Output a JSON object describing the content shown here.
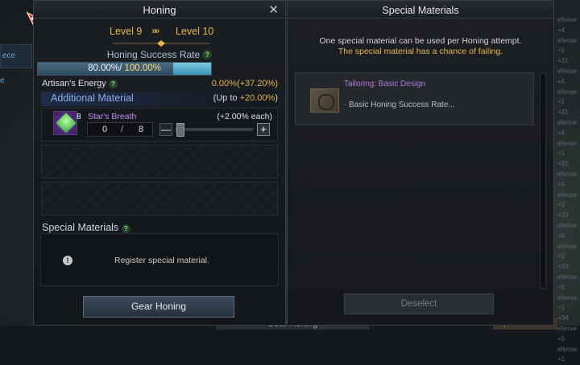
{
  "honing": {
    "title": "Honing",
    "level_from": "Level 9",
    "level_to": "Level 10",
    "arrows": "»»",
    "success_rate_label": "Honing Success Rate",
    "success_base": "80.00%",
    "success_sep": "/",
    "success_max": "100.00%",
    "success_fill": 0.78,
    "success_bonus_fill": 0.22,
    "artisan_label": "Artisan's Energy",
    "artisan_value": "0.00%(+37.20%)",
    "additional_title": "Additional Material",
    "additional_up_prefix": "(Up to ",
    "additional_up_value": "+20.00%",
    "additional_up_suffix": ")",
    "material": {
      "count": "8",
      "name": "Star's Breath",
      "each": "(+2.00% each)",
      "qty_current": "0",
      "qty_sep": "/",
      "qty_max": "8",
      "minus": "—",
      "plus": "+"
    },
    "special_title": "Special Materials",
    "register_text": "Register special material.",
    "gear_button": "Gear Honing"
  },
  "special": {
    "title": "Special Materials",
    "line1": "One special material can be used per Honing attempt.",
    "line2": "The special material has a chance of failing.",
    "item_name": "Tailoring: Basic Design",
    "item_desc": "Basic Honing Success Rate...",
    "deselect": "Deselect"
  },
  "background": {
    "left_tab": "ece",
    "left_tab2": "e",
    "right_lines": [
      "efense +4",
      "efense +1",
      "+31",
      "efense +4",
      "efense +1",
      "+31",
      "efense +4",
      "efense +1",
      "+31",
      "efense +4",
      "efense +1",
      "+33",
      "efense +5",
      "efense +1",
      "+33",
      "efense +5",
      "efense +1",
      "+34",
      "efense +5",
      "efense +1"
    ],
    "bottom_btn": "Gear Honing",
    "bottom_equip": "Equi"
  },
  "colors": {
    "gold": "#e5b84e",
    "purple": "#c78af0",
    "accent_blue": "#8ab0e8"
  }
}
